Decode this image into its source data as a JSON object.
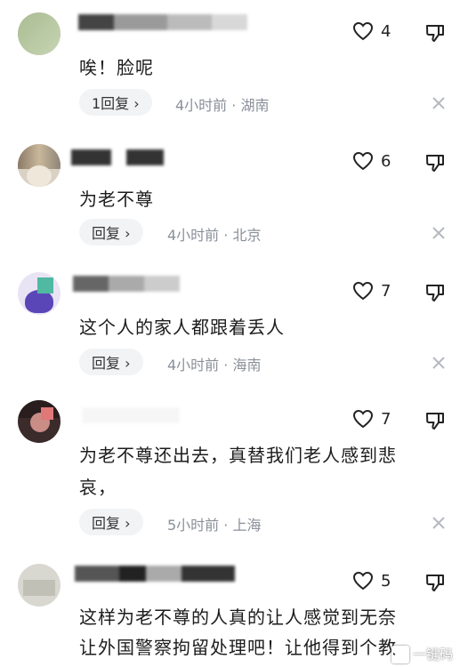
{
  "comments": [
    {
      "text": "唉！脸呢",
      "likes": "4",
      "reply": "1回复 ›",
      "meta": "4小时前 · 湖南"
    },
    {
      "text": "为老不尊",
      "likes": "6",
      "reply": "回复 ›",
      "meta": "4小时前 · 北京"
    },
    {
      "text": "这个人的家人都跟着丢人",
      "likes": "7",
      "reply": "回复 ›",
      "meta": "4小时前 · 海南"
    },
    {
      "text_line1": "为老不尊还出去，真替我们老人感到悲",
      "text_line2": "哀，",
      "likes": "7",
      "reply": "回复 ›",
      "meta": "5小时前 · 上海"
    },
    {
      "text_line1": "这样为老不尊的人真的让人感觉到无奈",
      "text_line2": "让外国警察拘留处理吧！让他得到个教",
      "likes": "5"
    }
  ],
  "watermark": "一键码",
  "icons": [
    "heart-outline-icon",
    "thumb-down-icon",
    "close-icon"
  ]
}
